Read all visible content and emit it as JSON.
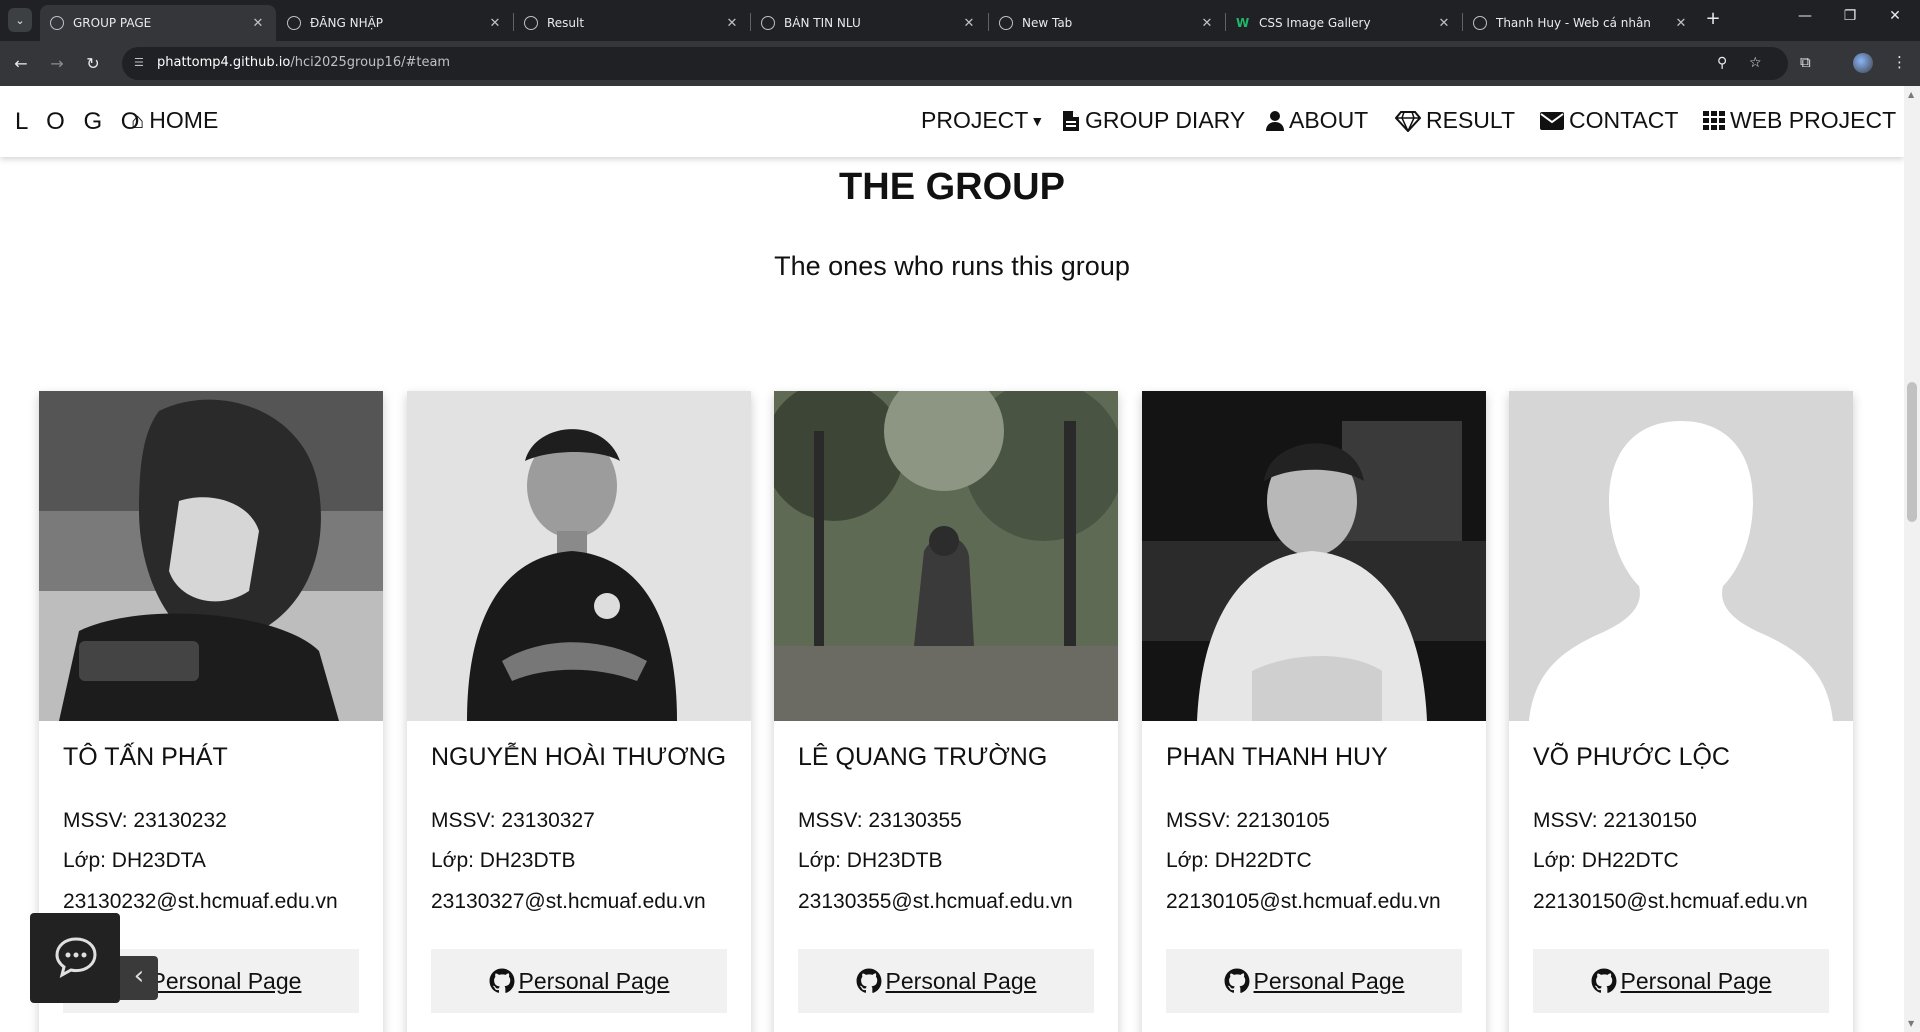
{
  "browser": {
    "tabs": [
      {
        "title": "GROUP PAGE",
        "active": true,
        "favicon": "globe-icon"
      },
      {
        "title": "ĐĂNG NHẬP",
        "active": false,
        "favicon": "globe-icon"
      },
      {
        "title": "Result",
        "active": false,
        "favicon": "globe-icon"
      },
      {
        "title": "BẢN TIN NLU",
        "active": false,
        "favicon": "globe-icon"
      },
      {
        "title": "New Tab",
        "active": false,
        "favicon": "chrome-icon"
      },
      {
        "title": "CSS Image Gallery",
        "active": false,
        "favicon": "w3schools-icon"
      },
      {
        "title": "Thanh Huy - Web cá nhân",
        "active": false,
        "favicon": "globe-icon"
      }
    ],
    "url_host": "phattomp4.github.io",
    "url_path": "/hci2025group16/#team"
  },
  "navbar": {
    "logo": "L O G O",
    "links": {
      "home": "HOME",
      "project": "PROJECT",
      "diary": "GROUP DIARY",
      "about": "ABOUT",
      "result": "RESULT",
      "contact": "CONTACT",
      "web_project": "WEB PROJECT"
    }
  },
  "section": {
    "title": "THE GROUP",
    "subtitle": "The ones who runs this group"
  },
  "members": [
    {
      "name": "TÔ TẤN PHÁT",
      "mssv": "MSSV: 23130232",
      "lop": "Lớp: DH23DTA",
      "email": "23130232@st.hcmuaf.edu.vn",
      "button": "Personal Page"
    },
    {
      "name": "NGUYỄN HOÀI THƯƠNG",
      "mssv": "MSSV: 23130327",
      "lop": "Lớp: DH23DTB",
      "email": "23130327@st.hcmuaf.edu.vn",
      "button": "Personal Page"
    },
    {
      "name": "LÊ QUANG TRƯỜNG",
      "mssv": "MSSV: 23130355",
      "lop": "Lớp: DH23DTB",
      "email": "23130355@st.hcmuaf.edu.vn",
      "button": "Personal Page"
    },
    {
      "name": "PHAN THANH HUY",
      "mssv": "MSSV: 22130105",
      "lop": "Lớp: DH22DTC",
      "email": "22130105@st.hcmuaf.edu.vn",
      "button": "Personal Page"
    },
    {
      "name": "VÕ PHƯỚC LỘC",
      "mssv": "MSSV: 22130150",
      "lop": "Lớp: DH22DTC",
      "email": "22130150@st.hcmuaf.edu.vn",
      "button": "Personal Page"
    }
  ],
  "colors": {
    "tabstrip": "#202124",
    "toolbar": "#35363a",
    "button_bg": "#f1f1f1",
    "chat_bg": "#222222"
  }
}
